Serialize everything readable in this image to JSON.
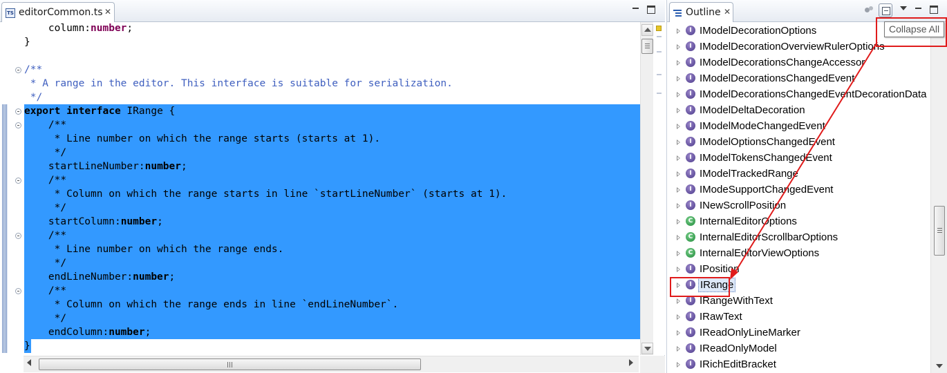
{
  "editor": {
    "tab_label": "editorCommon.ts",
    "tab_icon": "typescript-file-icon",
    "lines": [
      {
        "fold": false,
        "selected": false,
        "parts": [
          {
            "t": "    column:",
            "c": "plain"
          },
          {
            "t": "number",
            "c": "kw"
          },
          {
            "t": ";",
            "c": "plain"
          }
        ]
      },
      {
        "fold": false,
        "selected": false,
        "parts": [
          {
            "t": "}",
            "c": "plain"
          }
        ]
      },
      {
        "fold": false,
        "selected": false,
        "parts": []
      },
      {
        "fold": true,
        "selected": false,
        "parts": [
          {
            "t": "/**",
            "c": "cm"
          }
        ]
      },
      {
        "fold": false,
        "selected": false,
        "parts": [
          {
            "t": " * A range in the editor. This interface is suitable for serialization.",
            "c": "cm"
          }
        ]
      },
      {
        "fold": false,
        "selected": false,
        "parts": [
          {
            "t": " */",
            "c": "cm"
          }
        ]
      },
      {
        "fold": true,
        "selected": true,
        "parts": [
          {
            "t": "export",
            "c": "kw"
          },
          {
            "t": " ",
            "c": "plain"
          },
          {
            "t": "interface",
            "c": "kw"
          },
          {
            "t": " IRange {",
            "c": "plain"
          }
        ]
      },
      {
        "fold": true,
        "selected": true,
        "parts": [
          {
            "t": "    /**",
            "c": "cm"
          }
        ]
      },
      {
        "fold": false,
        "selected": true,
        "parts": [
          {
            "t": "     * Line number on which the range starts (starts at 1).",
            "c": "cm"
          }
        ]
      },
      {
        "fold": false,
        "selected": true,
        "parts": [
          {
            "t": "     */",
            "c": "cm"
          }
        ]
      },
      {
        "fold": false,
        "selected": true,
        "parts": [
          {
            "t": "    startLineNumber:",
            "c": "plain"
          },
          {
            "t": "number",
            "c": "kw"
          },
          {
            "t": ";",
            "c": "plain"
          }
        ]
      },
      {
        "fold": true,
        "selected": true,
        "parts": [
          {
            "t": "    /**",
            "c": "cm"
          }
        ]
      },
      {
        "fold": false,
        "selected": true,
        "parts": [
          {
            "t": "     * Column on which the range starts in line `startLineNumber` (starts at 1).",
            "c": "cm"
          }
        ]
      },
      {
        "fold": false,
        "selected": true,
        "parts": [
          {
            "t": "     */",
            "c": "cm"
          }
        ]
      },
      {
        "fold": false,
        "selected": true,
        "parts": [
          {
            "t": "    startColumn:",
            "c": "plain"
          },
          {
            "t": "number",
            "c": "kw"
          },
          {
            "t": ";",
            "c": "plain"
          }
        ]
      },
      {
        "fold": true,
        "selected": true,
        "parts": [
          {
            "t": "    /**",
            "c": "cm"
          }
        ]
      },
      {
        "fold": false,
        "selected": true,
        "parts": [
          {
            "t": "     * Line number on which the range ends.",
            "c": "cm"
          }
        ]
      },
      {
        "fold": false,
        "selected": true,
        "parts": [
          {
            "t": "     */",
            "c": "cm"
          }
        ]
      },
      {
        "fold": false,
        "selected": true,
        "parts": [
          {
            "t": "    endLineNumber:",
            "c": "plain"
          },
          {
            "t": "number",
            "c": "kw"
          },
          {
            "t": ";",
            "c": "plain"
          }
        ]
      },
      {
        "fold": true,
        "selected": true,
        "parts": [
          {
            "t": "    /**",
            "c": "cm"
          }
        ]
      },
      {
        "fold": false,
        "selected": true,
        "parts": [
          {
            "t": "     * Column on which the range ends in line `endLineNumber`.",
            "c": "cm"
          }
        ]
      },
      {
        "fold": false,
        "selected": true,
        "parts": [
          {
            "t": "     */",
            "c": "cm"
          }
        ]
      },
      {
        "fold": false,
        "selected": true,
        "parts": [
          {
            "t": "    endColumn:",
            "c": "plain"
          },
          {
            "t": "number",
            "c": "kw"
          },
          {
            "t": ";",
            "c": "plain"
          }
        ]
      },
      {
        "fold": false,
        "selected": true,
        "partial": true,
        "parts": [
          {
            "t": "}",
            "c": "plain"
          }
        ]
      }
    ]
  },
  "outline": {
    "tab_label": "Outline",
    "tooltip": "Collapse All",
    "items": [
      {
        "label": "IModelDecorationOptions",
        "kind": "interface",
        "icon_letter": "I"
      },
      {
        "label": "IModelDecorationOverviewRulerOptions",
        "kind": "interface",
        "icon_letter": "I"
      },
      {
        "label": "IModelDecorationsChangeAccessor",
        "kind": "interface",
        "icon_letter": "I"
      },
      {
        "label": "IModelDecorationsChangedEvent",
        "kind": "interface",
        "icon_letter": "I"
      },
      {
        "label": "IModelDecorationsChangedEventDecorationData",
        "kind": "interface",
        "icon_letter": "I"
      },
      {
        "label": "IModelDeltaDecoration",
        "kind": "interface",
        "icon_letter": "I"
      },
      {
        "label": "IModelModeChangedEvent",
        "kind": "interface",
        "icon_letter": "I"
      },
      {
        "label": "IModelOptionsChangedEvent",
        "kind": "interface",
        "icon_letter": "I"
      },
      {
        "label": "IModelTokensChangedEvent",
        "kind": "interface",
        "icon_letter": "I"
      },
      {
        "label": "IModelTrackedRange",
        "kind": "interface",
        "icon_letter": "I"
      },
      {
        "label": "IModeSupportChangedEvent",
        "kind": "interface",
        "icon_letter": "I"
      },
      {
        "label": "INewScrollPosition",
        "kind": "interface",
        "icon_letter": "I"
      },
      {
        "label": "InternalEditorOptions",
        "kind": "class",
        "icon_letter": "C"
      },
      {
        "label": "InternalEditorScrollbarOptions",
        "kind": "class",
        "icon_letter": "C"
      },
      {
        "label": "InternalEditorViewOptions",
        "kind": "class",
        "icon_letter": "C"
      },
      {
        "label": "IPosition",
        "kind": "interface",
        "icon_letter": "I"
      },
      {
        "label": "IRange",
        "kind": "interface",
        "icon_letter": "I",
        "selected": true
      },
      {
        "label": "IRangeWithText",
        "kind": "interface",
        "icon_letter": "I"
      },
      {
        "label": "IRawText",
        "kind": "interface",
        "icon_letter": "I"
      },
      {
        "label": "IReadOnlyLineMarker",
        "kind": "interface",
        "icon_letter": "I"
      },
      {
        "label": "IReadOnlyModel",
        "kind": "interface",
        "icon_letter": "I"
      },
      {
        "label": "IRichEditBracket",
        "kind": "interface",
        "icon_letter": "I"
      }
    ]
  },
  "colors": {
    "selection": "#3399ff",
    "keyword": "#7f0055",
    "comment": "#3f5fbf",
    "annotation": "#e01b1b",
    "interface_icon": "#4b3a8a",
    "class_icon": "#1f8a3a"
  }
}
